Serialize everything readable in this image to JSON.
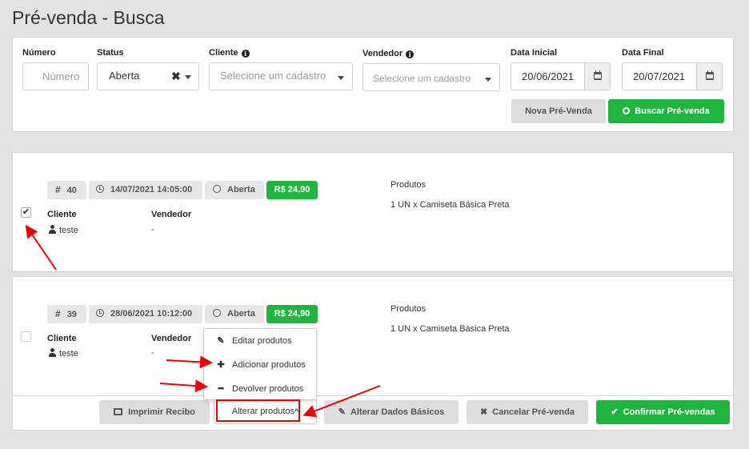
{
  "page": {
    "title": "Pré-venda - Busca"
  },
  "filters": {
    "numero": {
      "label": "Número",
      "placeholder": "Número"
    },
    "status": {
      "label": "Status",
      "value": "Aberta"
    },
    "cliente": {
      "label": "Cliente",
      "placeholder": "Selecione um cadastro"
    },
    "vendedor": {
      "label": "Vendedor",
      "placeholder": "Selecione um cadastro"
    },
    "data_inicial": {
      "label": "Data Inicial",
      "value": "20/06/2021"
    },
    "data_final": {
      "label": "Data Final",
      "value": "20/07/2021"
    },
    "nova_label": "Nova Pré-Venda",
    "buscar_label": "Buscar Pré-venda"
  },
  "orders": [
    {
      "number": "40",
      "datetime": "14/07/2021 14:05:00",
      "status": "Aberta",
      "total": "R$ 24,90",
      "cliente_label": "Cliente",
      "cliente": "teste",
      "vendedor_label": "Vendedor",
      "vendedor": "-",
      "produtos_label": "Produtos",
      "produtos": "1 UN x Camiseta Básica Preta",
      "checked": true
    },
    {
      "number": "39",
      "datetime": "28/06/2021 10:12:00",
      "status": "Aberta",
      "total": "R$ 24,90",
      "cliente_label": "Cliente",
      "cliente": "teste",
      "vendedor_label": "Vendedor",
      "vendedor": "-",
      "produtos_label": "Produtos",
      "produtos": "1 UN x Camiseta Básica Preta",
      "checked": false
    }
  ],
  "dropdown": {
    "items": [
      "Editar produtos",
      "Adicionar produtos",
      "Devolver produtos"
    ]
  },
  "footer": {
    "imprimir": "Imprimir Recibo",
    "alterar_produtos": "Alterar produtos",
    "alterar_dados": "Alterar Dados Básicos",
    "cancelar": "Cancelar Pré-venda",
    "confirmar": "Confirmar Pré-vendas"
  },
  "colors": {
    "green": "#1fb53e",
    "annotation": "#e00000"
  }
}
